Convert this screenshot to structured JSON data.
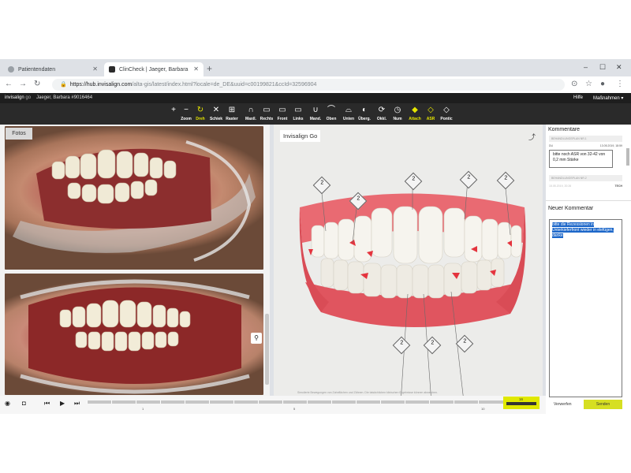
{
  "browser": {
    "tabs": [
      {
        "label": "Patientendaten",
        "active": false
      },
      {
        "label": "ClinCheck | Jaeger, Barbara",
        "active": true
      }
    ],
    "new_tab": "+",
    "window_controls": [
      "–",
      "☐",
      "✕"
    ],
    "url_host": "https://hub.invisalign.com",
    "url_rest": "/alta-gis/latest/index.html?locale=de_DE&uuid=c00199821&ccId=32596904"
  },
  "app_header": {
    "brand": "invisalign",
    "brand_sub": "go",
    "patient": "Jaeger, Barbara #9016464",
    "help": "Hilfe",
    "actions": "Maßnahmen ▾"
  },
  "toolbar": {
    "tools": [
      {
        "icon": "+",
        "label": "",
        "name": "zoom-in",
        "active": false
      },
      {
        "icon": "−",
        "label": "Zoom",
        "name": "zoom-out",
        "active": false
      },
      {
        "icon": "↻",
        "label": "Dreh",
        "name": "rotate",
        "active": true
      },
      {
        "icon": "✕",
        "label": "Schiek",
        "name": "schiek",
        "active": false
      },
      {
        "icon": "⊞",
        "label": "Raster",
        "name": "grid",
        "active": false
      },
      {
        "icon": "∩",
        "label": "Maxil.",
        "name": "maxilla",
        "active": false
      },
      {
        "icon": "▭",
        "label": "Rechts",
        "name": "right-view",
        "active": false
      },
      {
        "icon": "▭",
        "label": "Front",
        "name": "front-view",
        "active": false
      },
      {
        "icon": "▭",
        "label": "Links",
        "name": "left-view",
        "active": false
      },
      {
        "icon": "∪",
        "label": "Mand.",
        "name": "mandible",
        "active": false
      },
      {
        "icon": "⌒",
        "label": "Oben",
        "name": "top-view",
        "active": false
      },
      {
        "icon": "⌓",
        "label": "Unten",
        "name": "bottom-view",
        "active": false
      },
      {
        "icon": "◐",
        "label": "Überg.",
        "name": "transition",
        "active": false
      },
      {
        "icon": "⟳",
        "label": "Okkl.",
        "name": "occlusion",
        "active": false
      },
      {
        "icon": "◷",
        "label": "Num",
        "name": "numbers",
        "active": false
      },
      {
        "icon": "◆",
        "label": "Attach",
        "name": "attachments",
        "active": true
      },
      {
        "icon": "◇",
        "label": "ASR",
        "name": "asr",
        "active": true
      },
      {
        "icon": "◇",
        "label": "Pontic",
        "name": "pontic",
        "active": false
      }
    ]
  },
  "photos": {
    "tab_label": "Fotos",
    "zoom_icon": "⚲"
  },
  "viewer": {
    "title": "Invisalign Go",
    "disclaimer": "Simulierte Bewegungen von Zahnflächen und Zähnen. Die tatsächlichen klinischen Ergebnisse können abweichen.",
    "asr_markers": [
      "2",
      "2",
      "2",
      "2",
      "2",
      "2",
      "2",
      "2"
    ]
  },
  "comments": {
    "title": "Kommentare",
    "entry1_header": "BEHANDLUNGSPLAN NR.1",
    "entry1_date": "13.05.2019, 18:59",
    "entry1_author": "DU",
    "entry1_text": "bitte noch ASR von 32-42 von 0,2 mm Stärke",
    "entry2_header": "BEHANDLUNGSPLAN NR.2",
    "entry2_date": "15.05.2019, 20:26",
    "entry2_author": "TECH",
    "new_title": "Neuer Kommentar",
    "new_text": "bitte die Rezessionen in Unterkieferfront wieder in elefügen, danke",
    "discard": "Verwerfen",
    "send": "Senden"
  },
  "timeline": {
    "ticks": [
      "1",
      "5",
      "10"
    ],
    "current": "16",
    "accent": "#e0e800"
  }
}
